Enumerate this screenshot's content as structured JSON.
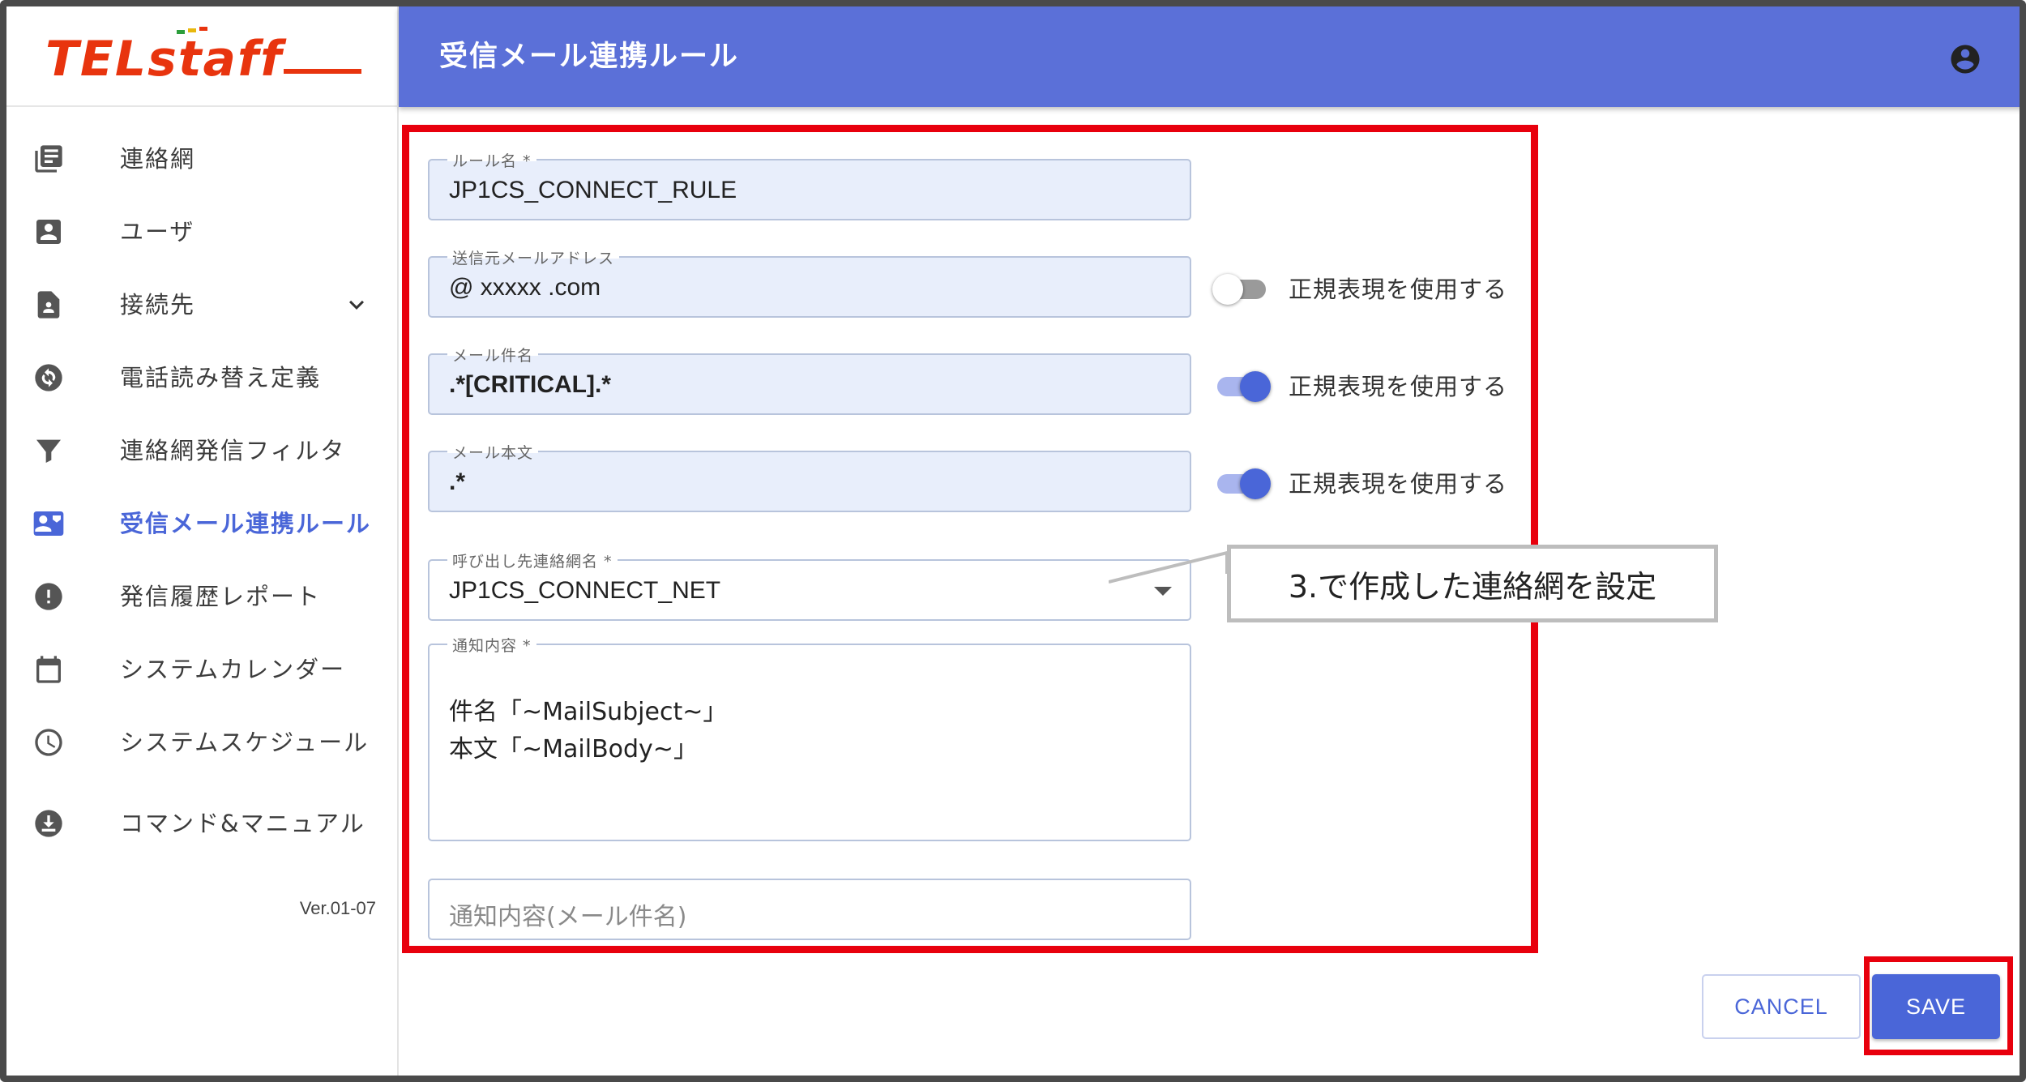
{
  "app": {
    "logo_text": "TELstaff",
    "title": "受信メール連携ルール",
    "version": "Ver.01-07"
  },
  "colors": {
    "accent": "#5b70d8",
    "primary_button": "#4a66d8",
    "highlight": "#e8000d",
    "logo": "#e8340e"
  },
  "sidebar": {
    "items": [
      {
        "label": "連絡網",
        "icon": "contact-list-icon",
        "active": false
      },
      {
        "label": "ユーザ",
        "icon": "user-badge-icon",
        "active": false
      },
      {
        "label": "接続先",
        "icon": "document-person-icon",
        "active": false,
        "expandable": true
      },
      {
        "label": "電話読み替え定義",
        "icon": "sync-icon",
        "active": false
      },
      {
        "label": "連絡網発信フィルタ",
        "icon": "filter-icon",
        "active": false
      },
      {
        "label": "受信メール連携ルール",
        "icon": "contact-mail-icon",
        "active": true
      },
      {
        "label": "発信履歴レポート",
        "icon": "alert-circle-icon",
        "active": false
      },
      {
        "label": "システムカレンダー",
        "icon": "calendar-icon",
        "active": false
      },
      {
        "label": "システムスケジュール",
        "icon": "clock-icon",
        "active": false
      },
      {
        "label": "コマンド&マニュアル",
        "icon": "download-circle-icon",
        "active": false
      }
    ]
  },
  "form": {
    "rule_name": {
      "label": "ルール名 *",
      "value": "JP1CS_CONNECT_RULE"
    },
    "sender_address": {
      "label": "送信元メールアドレス",
      "value": "@ xxxxx .com",
      "regex_label": "正規表現を使用する",
      "regex_enabled": false
    },
    "mail_subject": {
      "label": "メール件名",
      "value": ".*[CRITICAL].*",
      "regex_label": "正規表現を使用する",
      "regex_enabled": true
    },
    "mail_body": {
      "label": "メール本文",
      "value": ".*",
      "regex_label": "正規表現を使用する",
      "regex_enabled": true
    },
    "call_network": {
      "label": "呼び出し先連絡網名 *",
      "value": "JP1CS_CONNECT_NET"
    },
    "notification": {
      "label": "通知内容 *",
      "line1": "件名「~MailSubject~」",
      "line2": "本文「~MailBody~」"
    },
    "notification_subject": {
      "placeholder": "通知内容(メール件名)"
    }
  },
  "callout": {
    "text": "3.で作成した連絡網を設定"
  },
  "buttons": {
    "cancel": "CANCEL",
    "save": "SAVE"
  }
}
